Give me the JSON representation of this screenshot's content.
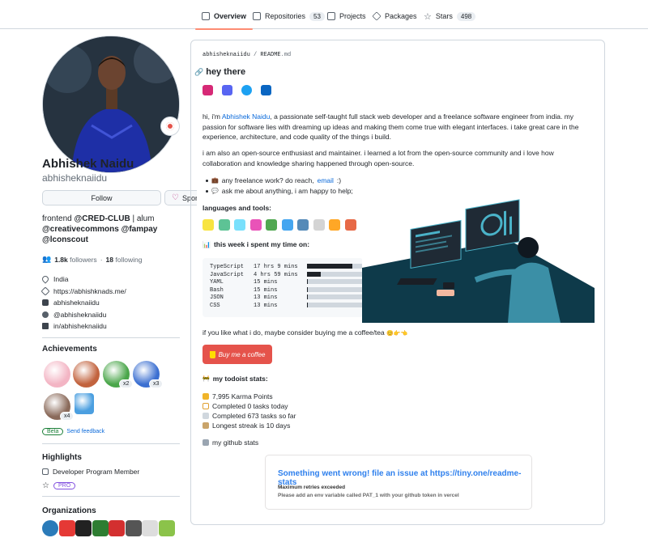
{
  "tabs": [
    {
      "label": "Overview",
      "count": null
    },
    {
      "label": "Repositories",
      "count": "53"
    },
    {
      "label": "Projects",
      "count": null
    },
    {
      "label": "Packages",
      "count": null
    },
    {
      "label": "Stars",
      "count": "498"
    }
  ],
  "profile": {
    "name": "Abhishek Naidu",
    "login": "abhisheknaiidu",
    "follow_label": "Follow",
    "sponsor_label": "Sponsor",
    "bio_prefix": "frontend ",
    "bio_cred": "@CRED-CLUB",
    "bio_alum": " | alum",
    "bio_line2": "@creativecommons @fampay",
    "bio_line3": "@lconscout",
    "followers_count": "1.8k",
    "followers_label": "followers",
    "sep": " · ",
    "following_count": "18",
    "following_label": "following",
    "location": "India",
    "website": "https://abhishknads.me/",
    "instagram": "abhisheknaiidu",
    "twitter": "@abhisheknaiidu",
    "linkedin": "in/abhisheknaiidu"
  },
  "achievements": {
    "title": "Achievements",
    "badges": [
      {
        "name": "yolo",
        "multiplier": null,
        "color": "#f3b5c4"
      },
      {
        "name": "starstruck",
        "multiplier": null,
        "color": "#c2633e"
      },
      {
        "name": "pair-extraordinaire",
        "multiplier": "x2",
        "color": "#4aa64a"
      },
      {
        "name": "pull-shark",
        "multiplier": "x3",
        "color": "#3b6fd1"
      },
      {
        "name": "quickdraw",
        "multiplier": "x4",
        "color": "#8a6a5a"
      },
      {
        "name": "arctic-code-vault",
        "multiplier": null,
        "color": "#4b9fe0"
      }
    ],
    "beta_label": "Beta",
    "feedback_label": "Send feedback"
  },
  "highlights": {
    "title": "Highlights",
    "items": [
      "Developer Program Member"
    ],
    "pro_label": "PRO"
  },
  "organizations": {
    "title": "Organizations",
    "colors": [
      "#2b7bb9",
      "#e53935",
      "#222222",
      "#2e7d32",
      "#d32f2f",
      "#555555",
      "#dddddd",
      "#8bc34a"
    ]
  },
  "readme": {
    "owner": "abhisheknaiidu",
    "separator": " / ",
    "file": "README",
    "ext": ".md",
    "heading": "hey there",
    "social_colors": [
      "#d62976",
      "#5865f2",
      "#1da1f2",
      "#0a66c2"
    ],
    "intro_1": "hi, i'm ",
    "intro_link": "Abhishek Naidu",
    "intro_2": ", a passionate self-taught full stack web developer and a freelance software engineer from india. my passion for software lies with dreaming up ideas and making them come true with elegant interfaces. i take great care in the experience, architecture, and code quality of the things i build.",
    "para2": "i am also an open-source enthusiast and maintainer. i learned a lot from the open-source community and i love how collaboration and knowledge sharing happened through open-source.",
    "bullet1_text": "any freelance work? do reach, ",
    "bullet1_link": "email",
    "bullet1_end": " :)",
    "bullet2_text": "ask me about anything, i am happy to help;",
    "tools_heading": "languages and tools:",
    "tool_colors": [
      "#f7df1e",
      "#41b883",
      "#61dafb",
      "#e535ab",
      "#339933",
      "#2496ed",
      "#3776ab",
      "#cccccc",
      "#ff9800",
      "#e34f26"
    ],
    "week_heading": "this week i spent my time on:",
    "wakatime": [
      {
        "lang": "TypeScript",
        "time": "17 hrs 9 mins",
        "pct": 80
      },
      {
        "lang": "JavaScript",
        "time": "4 hrs 59 mins",
        "pct": 24
      },
      {
        "lang": "YAML",
        "time": "15 mins",
        "pct": 2
      },
      {
        "lang": "Bash",
        "time": "15 mins",
        "pct": 2
      },
      {
        "lang": "JSON",
        "time": "13 mins",
        "pct": 2
      },
      {
        "lang": "CSS",
        "time": "13 mins",
        "pct": 2
      }
    ],
    "coffee_text": "if you like what i do, maybe consider buying me a coffee/tea ",
    "coffee_button": "Buy me a coffee",
    "todoist_heading": "my todoist stats:",
    "todoist": [
      "7,995 Karma Points",
      "Completed 0 tasks today",
      "Completed 673 tasks so far",
      "Longest streak is 10 days"
    ],
    "github_stats": "my github stats",
    "error_title": "Something went wrong! file an issue at https://tiny.one/readme-stats",
    "error_sub": "Maximum retries exceeded",
    "error_hint": "Please add an env variable called PAT_1 with your github token in vercel"
  }
}
